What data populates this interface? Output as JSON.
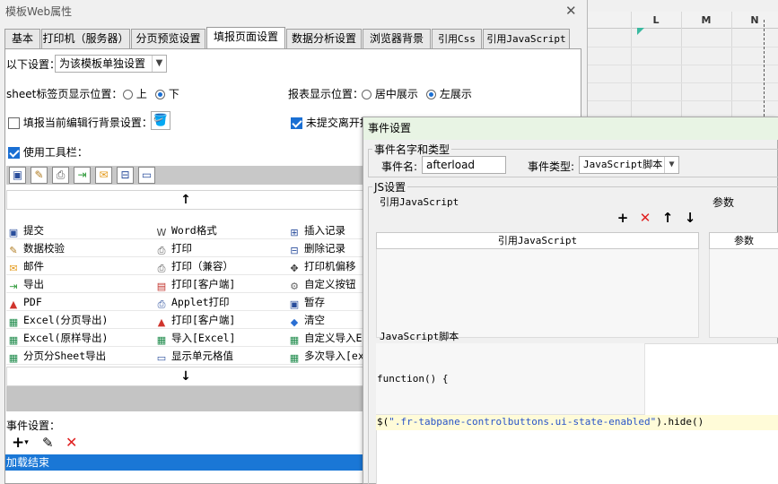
{
  "sheet": {
    "columns": [
      "L",
      "M",
      "N"
    ]
  },
  "dialog": {
    "title": "模板Web属性",
    "tabs": [
      "基本",
      "打印机（服务器）",
      "分页预览设置",
      "填报页面设置",
      "数据分析设置",
      "浏览器背景",
      "引用Css",
      "引用JavaScript"
    ],
    "active_tab": "填报页面设置",
    "settings_label": "以下设置：",
    "settings_select": "为该模板单独设置",
    "sheet_tab_label": "sheet标签页显示位置：",
    "sheet_tab_up": "上",
    "sheet_tab_down": "下",
    "report_pos_label": "报表显示位置：",
    "report_center": "居中展示",
    "report_left": "左展示",
    "row_bg_label": "填报当前编辑行背景设置：",
    "unsubmitted_label": "未提交离开提",
    "use_toolbar_label": "使用工具栏：",
    "event_settings_label": "事件设置：",
    "event_item": "加载结束",
    "toolbar_items": [
      {
        "label": "提交",
        "icon": "save-icon"
      },
      {
        "label": "Word格式",
        "icon": "word-icon"
      },
      {
        "label": "插入记录",
        "icon": "insert-row-icon"
      },
      {
        "label": "数据校验",
        "icon": "validate-icon"
      },
      {
        "label": "打印",
        "icon": "print-icon"
      },
      {
        "label": "删除记录",
        "icon": "delete-row-icon"
      },
      {
        "label": "邮件",
        "icon": "mail-icon"
      },
      {
        "label": "打印（兼容）",
        "icon": "print-icon"
      },
      {
        "label": "打印机偏移",
        "icon": "move-icon"
      },
      {
        "label": "导出",
        "icon": "export-icon"
      },
      {
        "label": "打印[客户端]",
        "icon": "pdf-print-icon"
      },
      {
        "label": "自定义按钮",
        "icon": "gear-icon"
      },
      {
        "label": "PDF",
        "icon": "pdf-icon"
      },
      {
        "label": "Applet打印",
        "icon": "applet-print-icon"
      },
      {
        "label": "暂存",
        "icon": "save-icon"
      },
      {
        "label": "Excel(分页导出)",
        "icon": "excel-icon"
      },
      {
        "label": "打印[客户端]",
        "icon": "pdf-icon"
      },
      {
        "label": "清空",
        "icon": "eraser-icon"
      },
      {
        "label": "Excel(原样导出)",
        "icon": "excel-icon"
      },
      {
        "label": "导入[Excel]",
        "icon": "excel-icon"
      },
      {
        "label": "自定义导入E",
        "icon": "excel-icon"
      },
      {
        "label": "分页分Sheet导出",
        "icon": "excel-icon"
      },
      {
        "label": "显示单元格值",
        "icon": "cell-icon"
      },
      {
        "label": "多次导入[ex",
        "icon": "excel-icon"
      }
    ]
  },
  "event_dialog": {
    "title": "事件设置",
    "name_type_group": "事件名字和类型",
    "event_name_label": "事件名:",
    "event_name_value": "afterload",
    "event_type_label": "事件类型:",
    "event_type_value": "JavaScript脚本",
    "js_group": "JS设置",
    "ref_js_label": "引用JavaScript",
    "params_label": "参数",
    "ref_js_col": "引用JavaScript",
    "params_col": "参数",
    "js_script_label": "JavaScript脚本",
    "code_line1": "function() {",
    "code_line2_prefix": "$(",
    "code_line2_string": "\".fr-tabpane-controlbuttons.ui-state-enabled\"",
    "code_line2_suffix": ").hide()"
  }
}
